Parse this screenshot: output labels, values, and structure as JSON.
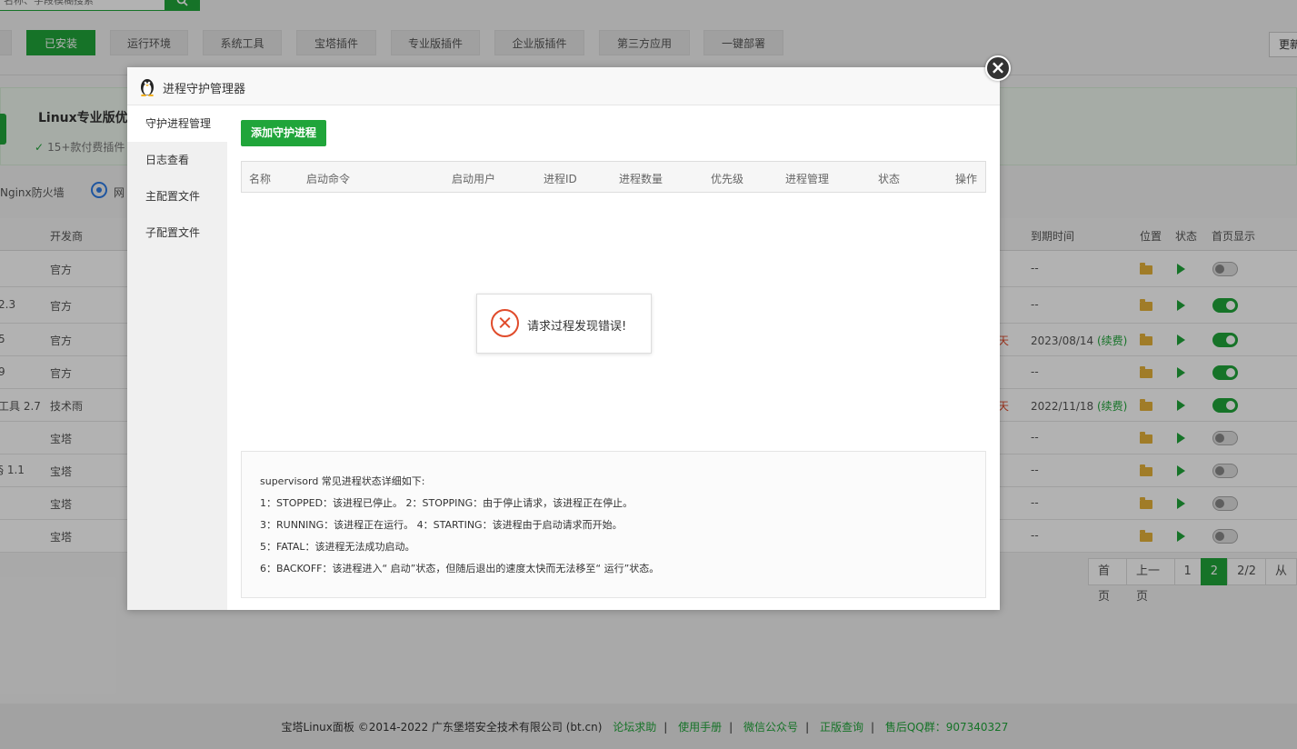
{
  "search": {
    "placeholder": "名称、字段模糊搜索"
  },
  "tabs": [
    {
      "label": "已安装",
      "active": true
    },
    {
      "label": "运行环境"
    },
    {
      "label": "系统工具"
    },
    {
      "label": "宝塔插件"
    },
    {
      "label": "专业版插件"
    },
    {
      "label": "企业版插件"
    },
    {
      "label": "第三方应用"
    },
    {
      "label": "一键部署"
    }
  ],
  "update_label": "更新",
  "promo": {
    "title": "Linux专业版优惠",
    "sub": "15+款付费插件"
  },
  "quick": {
    "nginx": "Nginx防火墙",
    "net": "网"
  },
  "table": {
    "headers": {
      "developer": "开发商",
      "expire": "到期时间",
      "position": "位置",
      "status": "状态",
      "home": "首页显示"
    },
    "rows": [
      {
        "name": "",
        "dev": "官方",
        "days": "",
        "expire": "--",
        "renew": "",
        "home_on": false
      },
      {
        "name": "2.3",
        "dev": "官方",
        "days": "",
        "expire": "--",
        "renew": "",
        "home_on": true
      },
      {
        "name": "5",
        "dev": "官方",
        "days": "天",
        "expire": "2023/08/14",
        "renew": "(续费)",
        "home_on": true
      },
      {
        "name": "9",
        "dev": "官方",
        "days": "",
        "expire": "--",
        "renew": "",
        "home_on": true
      },
      {
        "name": "工具 2.7",
        "dev": "技术雨",
        "days": "天",
        "expire": "2022/11/18",
        "renew": "(续费)",
        "home_on": true
      },
      {
        "name": "",
        "dev": "宝塔",
        "days": "",
        "expire": "--",
        "renew": "",
        "home_on": false
      },
      {
        "name": "§ 1.1",
        "dev": "宝塔",
        "days": "",
        "expire": "--",
        "renew": "",
        "home_on": false
      },
      {
        "name": "",
        "dev": "宝塔",
        "days": "",
        "expire": "--",
        "renew": "",
        "home_on": false
      },
      {
        "name": "",
        "dev": "宝塔",
        "days": "",
        "expire": "--",
        "renew": "",
        "home_on": false
      }
    ]
  },
  "pager": {
    "first": "首页",
    "prev": "上一页",
    "p1": "1",
    "p2": "2",
    "total": "2/2",
    "from": "从"
  },
  "footer": {
    "copyright": "宝塔Linux面板 ©2014-2022 广东堡塔安全技术有限公司 (bt.cn)",
    "links": [
      "论坛求助",
      "使用手册",
      "微信公众号",
      "正版查询",
      "售后QQ群：907340327"
    ],
    "sep": "|"
  },
  "modal": {
    "title": "进程守护管理器",
    "close_icon": "×",
    "nav": [
      "守护进程管理",
      "日志查看",
      "主配置文件",
      "子配置文件"
    ],
    "add_button": "添加守护进程",
    "columns": [
      "名称",
      "启动命令",
      "启动用户",
      "进程ID",
      "进程数量",
      "优先级",
      "进程管理",
      "状态",
      "操作"
    ],
    "error": "请求过程发现错误!",
    "notes": [
      "supervisord 常见进程状态详细如下:",
      "1：STOPPED：该进程已停止。    2：STOPPING：由于停止请求，该进程正在停止。",
      "3：RUNNING：该进程正在运行。 4：STARTING：该进程由于启动请求而开始。",
      "5：FATAL：该进程无法成功启动。",
      "6：BACKOFF：该进程进入“ 启动”状态，但随后退出的速度太快而无法移至“ 运行”状态。"
    ]
  },
  "colors": {
    "accent": "#20a53a",
    "error": "#e04b2b"
  }
}
